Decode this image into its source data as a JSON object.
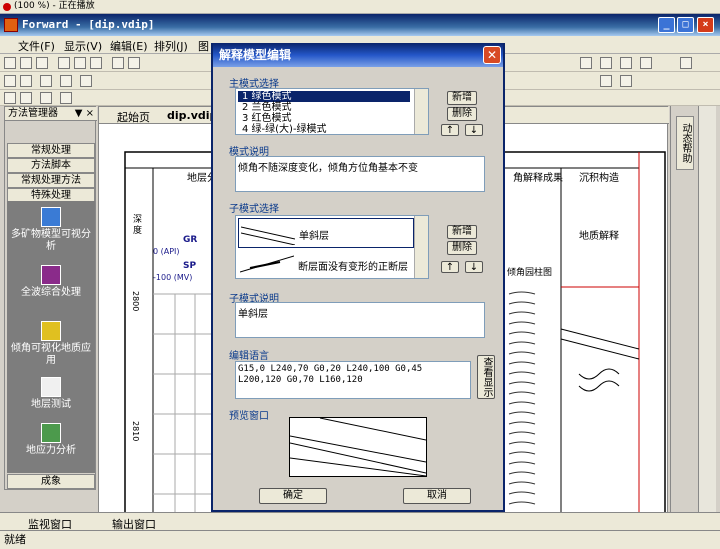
{
  "player": {
    "title": "(100 %) - 正在播放"
  },
  "window": {
    "title": "Forward - [dip.vdip]"
  },
  "menu": [
    "文件(F)",
    "显示(V)",
    "编辑(E)",
    "排列(J)",
    "图"
  ],
  "left_panel": {
    "title": "方法管理器",
    "pin": "▼ ×",
    "categories": [
      "常规处理",
      "方法脚本",
      "常规处理方法",
      "特殊处理"
    ],
    "tools": [
      "多矿物模型可视分析",
      "全波综合处理",
      "倾角可视化地质应用",
      "地层测试",
      "地应力分析"
    ],
    "footer": "成象"
  },
  "doc_tabs": {
    "home": "起始页",
    "file": "dip.vdip"
  },
  "doc": {
    "col_stratum": "地层分析",
    "col_dip": "角解释成果",
    "col_sed": "沉积构造",
    "depth": "深度",
    "gr": "GR",
    "gr_range": "0    (API)",
    "sp": "SP",
    "sp_range": "-100   (MV)",
    "depth_2800": "2800",
    "depth_2810": "2810",
    "geo": "地质解释",
    "circle": "倾角园柱图"
  },
  "right_tab": "动态帮助",
  "bottom_tabs": {
    "monitor": "监视窗口",
    "output": "输出窗口"
  },
  "status": "就绪",
  "dialog": {
    "title": "解释模型编辑",
    "main_mode_label": "主模式选择",
    "main_modes": [
      "1 绿色模式",
      "2 兰色模式",
      "3 红色模式",
      "4 绿-绿(大)-绿模式"
    ],
    "new_btn": "新增",
    "del_btn": "删除",
    "up_btn": "↑",
    "down_btn": "↓",
    "mode_desc_label": "模式说明",
    "mode_desc": "倾角不随深度变化，倾角方位角基本不变",
    "sub_mode_label": "子模式选择",
    "sub_modes": [
      "单斜层",
      "断层面没有变形的正断层"
    ],
    "sub_desc_label": "子模式说明",
    "sub_desc": "单斜层",
    "code_label": "编辑语言",
    "code_text": "G15,0 L240,70 G0,20 L240,100 G0,45 L200,120 G0,70 L160,120",
    "view_btn": "查看显示",
    "preview_label": "预览窗口",
    "ok_btn": "确定",
    "cancel_btn": "取消"
  }
}
